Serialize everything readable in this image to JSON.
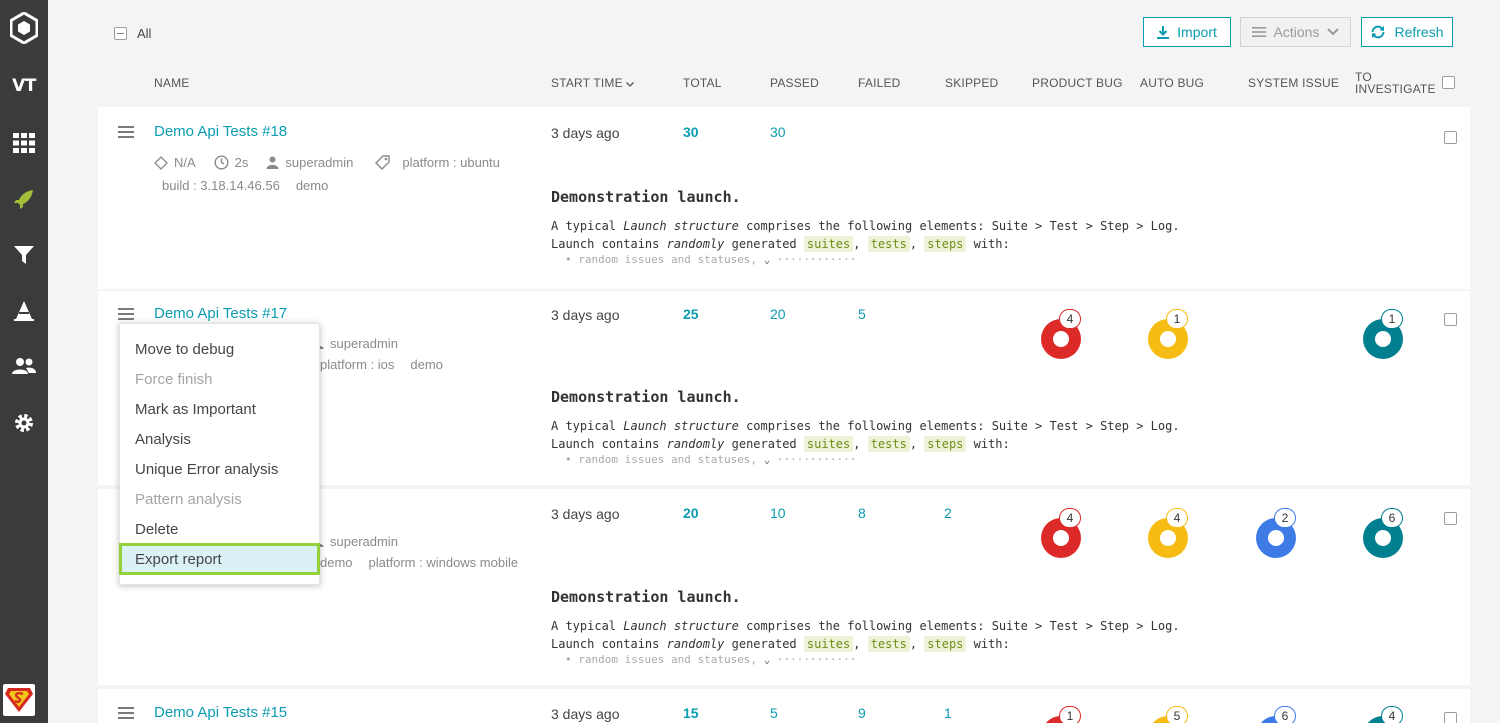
{
  "sidebar": {
    "logo_text": "VT",
    "items": [
      {
        "name": "logo-icon"
      },
      {
        "name": "project-badge",
        "label": "VT"
      },
      {
        "name": "dashboard-icon"
      },
      {
        "name": "launches-icon"
      },
      {
        "name": "filters-icon"
      },
      {
        "name": "debug-icon"
      },
      {
        "name": "members-icon"
      },
      {
        "name": "settings-icon"
      }
    ]
  },
  "toolbar": {
    "all_label": "All",
    "import_label": "Import",
    "actions_label": "Actions",
    "refresh_label": "Refresh"
  },
  "columns": {
    "name": "NAME",
    "start_time": "START TIME",
    "total": "TOTAL",
    "passed": "PASSED",
    "failed": "FAILED",
    "skipped": "SKIPPED",
    "product_bug": "PRODUCT BUG",
    "auto_bug": "AUTO BUG",
    "system_issue": "SYSTEM ISSUE",
    "to_investigate_1": "TO",
    "to_investigate_2": "INVESTIGATE"
  },
  "launches": [
    {
      "name": "Demo Api Tests #18",
      "meta_na": "N/A",
      "duration": "2s",
      "owner": "superadmin",
      "attr1": "platform : ubuntu",
      "attr2": "build : 3.18.14.46.56",
      "attr3": "demo",
      "start_time": "3 days ago",
      "total": "30",
      "passed": "30",
      "failed": "",
      "skipped": "",
      "product_bug": "",
      "auto_bug": "",
      "system_issue": "",
      "to_investigate": ""
    },
    {
      "name": "Demo Api Tests #17",
      "owner": "superadmin",
      "attr1": "platform : ios",
      "attr2": "demo",
      "start_time": "3 days ago",
      "total": "25",
      "passed": "20",
      "failed": "5",
      "skipped": "",
      "product_bug": "4",
      "auto_bug": "1",
      "system_issue": "",
      "to_investigate": "1"
    },
    {
      "name": "",
      "owner": "superadmin",
      "attr1": "demo",
      "attr2": "platform : windows mobile",
      "start_time": "3 days ago",
      "total": "20",
      "passed": "10",
      "failed": "8",
      "skipped": "2",
      "product_bug": "4",
      "auto_bug": "4",
      "system_issue": "2",
      "to_investigate": "6"
    },
    {
      "name": "Demo Api Tests #15",
      "start_time": "3 days ago",
      "total": "15",
      "passed": "5",
      "failed": "9",
      "skipped": "1",
      "product_bug": "1",
      "auto_bug": "5",
      "system_issue": "6",
      "to_investigate": "4"
    }
  ],
  "description": {
    "title": "Demonstration launch.",
    "line1_a": "A typical ",
    "line1_b": "Launch structure",
    "line1_c": " comprises the following elements: Suite > Test > Step > Log.",
    "line2_a": "Launch contains ",
    "line2_b": "randomly",
    "line2_c": " generated ",
    "tag1": "suites",
    "tag2": "tests",
    "tag3": "steps",
    "line2_d": " with:",
    "line3": "• random issues and statuses,"
  },
  "context_menu": {
    "items": [
      {
        "label": "Move to debug",
        "enabled": true
      },
      {
        "label": "Force finish",
        "enabled": false
      },
      {
        "label": "Mark as Important",
        "enabled": true
      },
      {
        "label": "Analysis",
        "enabled": true
      },
      {
        "label": "Unique Error analysis",
        "enabled": true
      },
      {
        "label": "Pattern analysis",
        "enabled": false
      },
      {
        "label": "Delete",
        "enabled": true
      },
      {
        "label": "Export report",
        "enabled": true,
        "highlighted": true
      }
    ]
  },
  "colors": {
    "accent": "#0b9cb1",
    "product_bug": "#dc2a28",
    "auto_bug": "#f7bc13",
    "system_issue": "#3e7be6",
    "to_investigate": "#007f90",
    "active_nav": "#a2c037"
  }
}
